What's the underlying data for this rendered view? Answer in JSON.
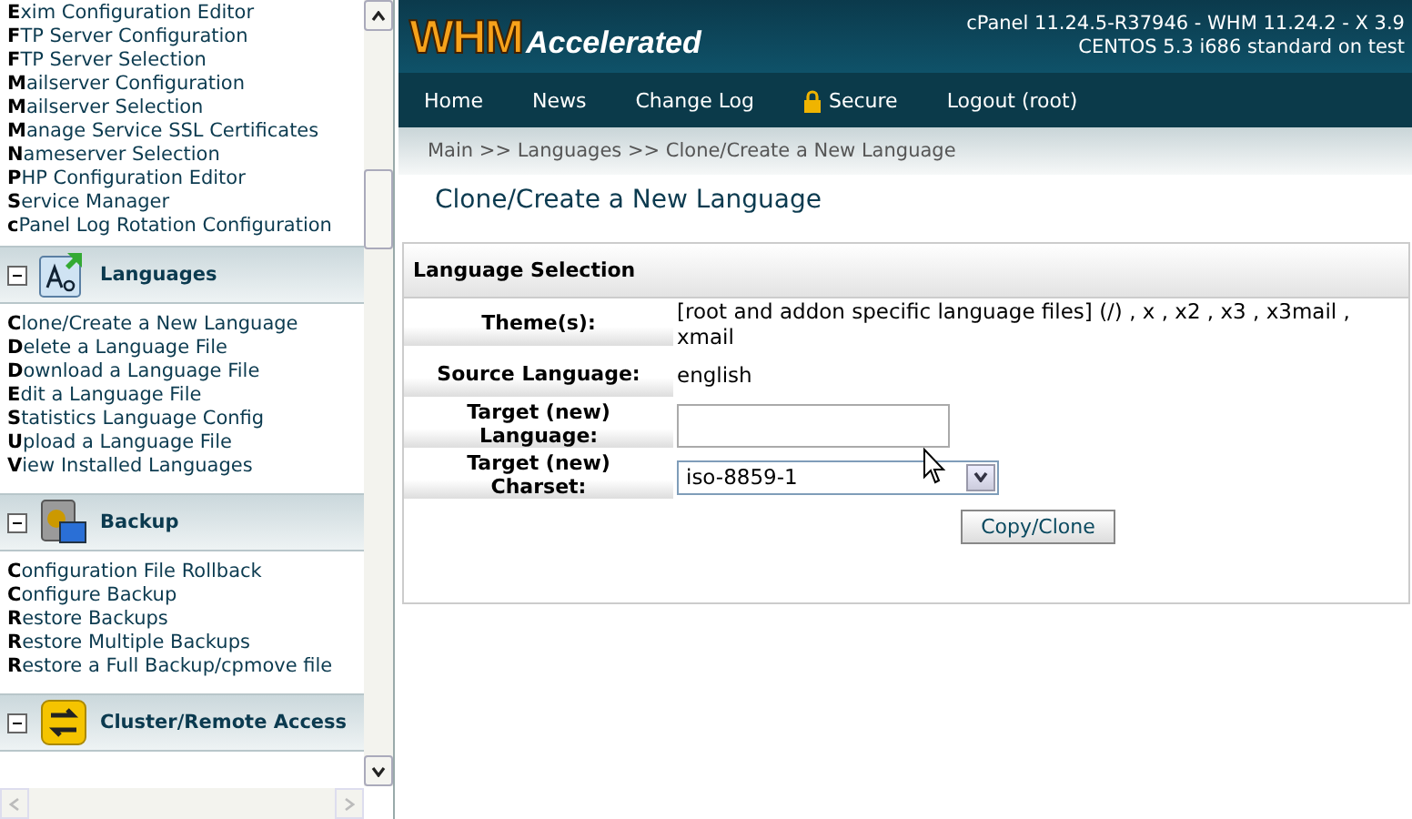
{
  "sidebar": {
    "sections": [
      {
        "kind": "plain",
        "items": [
          "**E**xim Configuration Editor",
          "**F**TP Server Configuration",
          "**F**TP Server Selection",
          "**M**ailserver Configuration",
          "**M**ailserver Selection",
          "**M**anage Service SSL Certificates",
          "**N**ameserver Selection",
          "**P**HP Configuration Editor",
          "**S**ervice Manager",
          "**c**Panel Log Rotation Configuration"
        ]
      },
      {
        "kind": "languages",
        "title": "Languages",
        "expanded": true,
        "items": [
          "**C**lone/Create a New Language",
          "**D**elete a Language File",
          "**D**ownload a Language File",
          "**E**dit a Language File",
          "**S**tatistics Language Config",
          "**U**pload a Language File",
          "**V**iew Installed Languages"
        ]
      },
      {
        "kind": "backup",
        "title": "Backup",
        "expanded": true,
        "items": [
          "**C**onfiguration File Rollback",
          "**C**onfigure Backup",
          "**R**estore Backups",
          "**R**estore Multiple Backups",
          "**R**estore a Full Backup/cpmove file"
        ]
      },
      {
        "kind": "cluster",
        "title": "Cluster/Remote Access",
        "expanded": true
      }
    ]
  },
  "header": {
    "logo_main": "WHM",
    "logo_sub": "Accelerated",
    "version_lines": [
      "cPanel 11.24.5-R37946 - WHM 11.24.2 - X 3.9",
      "CENTOS 5.3 i686 standard on test"
    ]
  },
  "nav": [
    {
      "label": "Home",
      "kind": "plain"
    },
    {
      "label": "News",
      "kind": "plain"
    },
    {
      "label": "Change Log",
      "kind": "plain"
    },
    {
      "label": "Secure",
      "kind": "lock"
    },
    {
      "label": "Logout (root)",
      "kind": "plain"
    }
  ],
  "breadcrumb": "Main >> Languages >> Clone/Create a New Language",
  "page_title": "Clone/Create a New Language",
  "form": {
    "title": "Language Selection",
    "rows": [
      {
        "label": "Theme(s):",
        "kind": "text",
        "value": "[root and addon specific language files] (/) , x , x2 , x3 , x3mail , xmail"
      },
      {
        "label": "Source Language:",
        "kind": "text",
        "value": "english"
      },
      {
        "label": "Target (new) Language:",
        "kind": "input",
        "value": ""
      },
      {
        "label": "Target (new) Charset:",
        "kind": "select",
        "value": "iso-8859-1"
      }
    ],
    "button": "Copy/Clone"
  }
}
